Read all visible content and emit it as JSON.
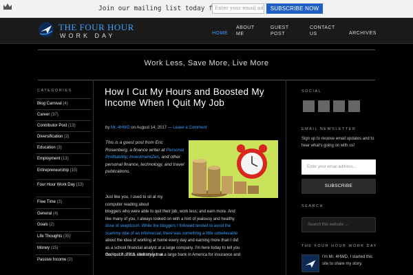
{
  "topbar": {
    "message": "Join our mailing list today for free.",
    "email_placeholder": "Enter your email address",
    "subscribe_label": "SUBSCRIBE NOW"
  },
  "header": {
    "logo_line1": "THE FOUR HOUR",
    "logo_line2": "WORK DAY",
    "nav": [
      {
        "label": "HOME",
        "active": true
      },
      {
        "label": "ABOUT ME"
      },
      {
        "label": "GUEST POST"
      },
      {
        "label": "CONTACT US"
      },
      {
        "label": "ARCHIVES"
      }
    ]
  },
  "tagline": "Work Less, Save More, Live More",
  "sidebar_left": {
    "title": "CATEGORIES",
    "categories": [
      {
        "name": "Blog Carnival",
        "count": "(4)"
      },
      {
        "name": "Career",
        "count": "(37)"
      },
      {
        "name": "Contributor Post",
        "count": "(13)"
      },
      {
        "name": "Diversification",
        "count": "(2)"
      },
      {
        "name": "Education",
        "count": "(3)"
      },
      {
        "name": "Employment",
        "count": "(13)"
      },
      {
        "name": "Entrepreneurship",
        "count": "(15)"
      },
      {
        "name": "Four Hour Work Day",
        "count": "(13)"
      },
      {
        "name": "Free Time",
        "count": "(3)"
      },
      {
        "name": "General",
        "count": "(4)"
      },
      {
        "name": "Goals",
        "count": "(2)"
      },
      {
        "name": "Life Thoughts",
        "count": "(35)"
      },
      {
        "name": "Money",
        "count": "(15)"
      },
      {
        "name": "Passive Income",
        "count": "(2)"
      }
    ]
  },
  "post": {
    "title": "How I Cut My Hours and Boosted My Income When I Quit My Job",
    "meta_by": "by",
    "meta_author": "Mr. 4HWD",
    "meta_on": "on August 14, 2017",
    "meta_comment": "— Leave a Comment",
    "intro_1": "This is a guest post from Eric Rosenberg, a finance writer at",
    "intro_site1": "Personal Profitability",
    "intro_site2": "InvestmentZen",
    "intro_2": ", and other personal finance, technology, and travel publications.",
    "body_lines": [
      "Just like you, I used to sit at my",
      "computer reading about",
      "bloggers who were able to quit their job, work less, and earn more. And",
      "like many of you, I always looked on with a hint of jealousy and healthy",
      "dose of skepticism. While the bloggers I followed tended to avoid the",
      "scammy vibe of an infomercial, there was something a little unbelievable",
      "about the idea of working at home every day and earning more than I did",
      "as a school financial analyst at a large company. I'm here today to tell you",
      "that much of it is absolutely true."
    ],
    "body_last": "On April 8, 2016, I left my job at a large bank in America for insurance and"
  },
  "sidebar_right": {
    "social_title": "SOCIAL",
    "newsletter_title": "EMAIL NEWSLETTER",
    "newsletter_text": "Sign up to receive email updates and to hear what's going on with us!",
    "email_placeholder": "Enter your email address...",
    "subscribe_label": "SUBSCRIBE",
    "search_title": "SEARCH",
    "search_placeholder": "Search this website ...",
    "about_title": "THE FOUR HOUR WORK DAY",
    "about_text": "I'm Mr. 4HWD, I started this site to share my story."
  },
  "colors": {
    "accent": "#3aa0ff",
    "subscribe_blue": "#1f5fc6",
    "background": "#000000"
  }
}
